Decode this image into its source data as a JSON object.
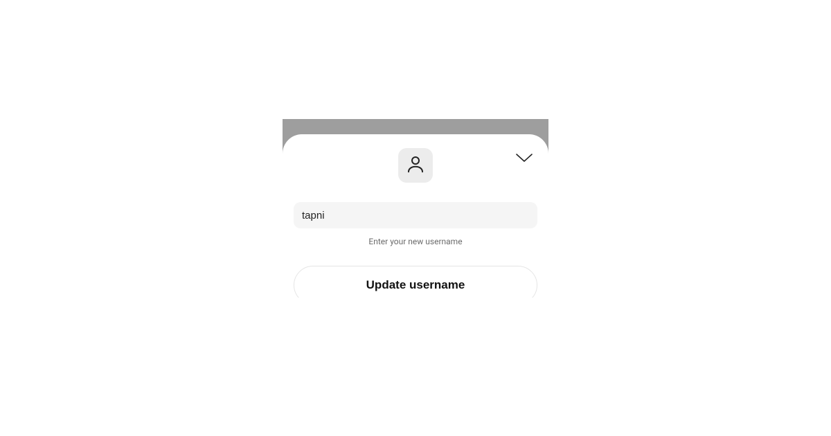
{
  "form": {
    "username_value": "tapni",
    "username_placeholder": "",
    "hint": "Enter your new username",
    "submit_label": "Update username"
  },
  "icons": {
    "avatar": "user-icon",
    "close": "chevron-down-icon"
  }
}
